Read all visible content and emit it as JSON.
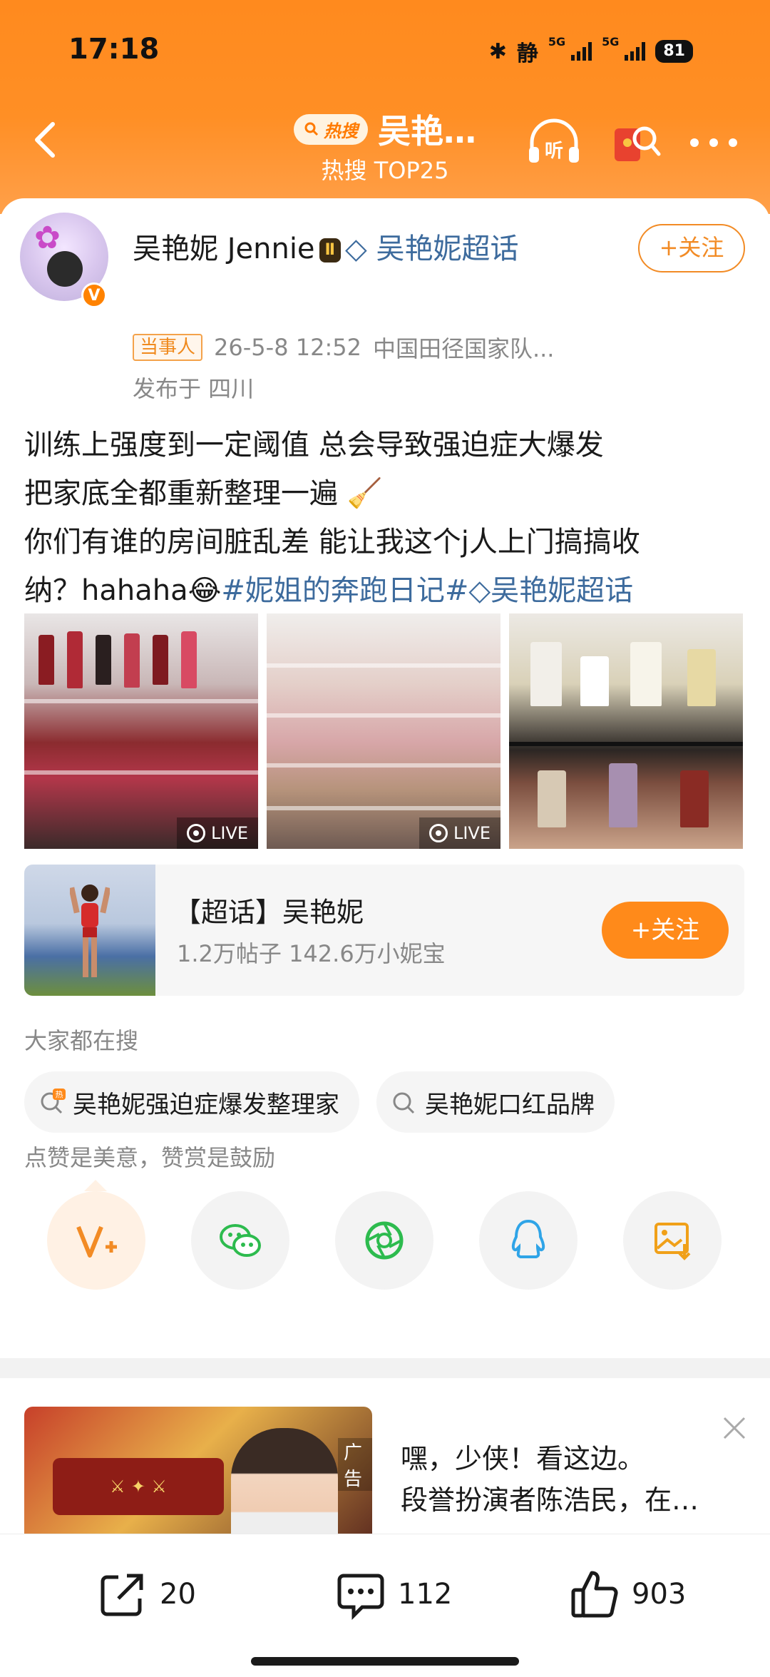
{
  "status_bar": {
    "time": "17:18",
    "mute": "静",
    "network_1": "5G",
    "network_2": "5G",
    "battery": "81"
  },
  "nav": {
    "hot_badge": "热搜",
    "title": "吴艳…",
    "subtitle": "热搜 TOP25"
  },
  "post": {
    "author_name": "吴艳妮 Jennie",
    "author_badge": "Ⅱ",
    "supertopic_link": "吴艳妮超话",
    "follow_label": "+关注",
    "meta_tag": "当事人",
    "time": "26-5-8 12:52",
    "source": "中国田径国家队...",
    "location": "发布于 四川",
    "text_line1": "训练上强度到一定阈值 总会导致强迫症大爆发",
    "text_line2": "把家底全都重新整理一遍 🧹",
    "text_line3": "你们有谁的房间脏乱差 能让我这个j人上门搞搞收",
    "text_line4_prefix": "纳？hahaha😂",
    "hashtag": "#妮姐的奔跑日记#",
    "supertopic_tag": "吴艳妮超话",
    "live_label_1": "LIVE",
    "live_label_2": "LIVE"
  },
  "supertopic_card": {
    "title": "【超话】吴艳妮",
    "stats": "1.2万帖子 142.6万小妮宝",
    "follow_label": "+关注"
  },
  "searches": {
    "label": "大家都在搜",
    "items": [
      "吴艳妮强迫症爆发整理家",
      "吴艳妮口红品牌"
    ]
  },
  "encourage": {
    "text": "点赞是美意，赞赏是鼓励"
  },
  "ad": {
    "tag": "广告",
    "line1": "嘿，少侠！看这边。",
    "line2": "段誉扮演者陈浩民，在…"
  },
  "actions": {
    "repost_count": "20",
    "comment_count": "112",
    "like_count": "903"
  },
  "colors": {
    "brand_orange": "#ff8a1e",
    "link_blue": "#3d6b9d",
    "follow_orange": "#f28b25"
  }
}
